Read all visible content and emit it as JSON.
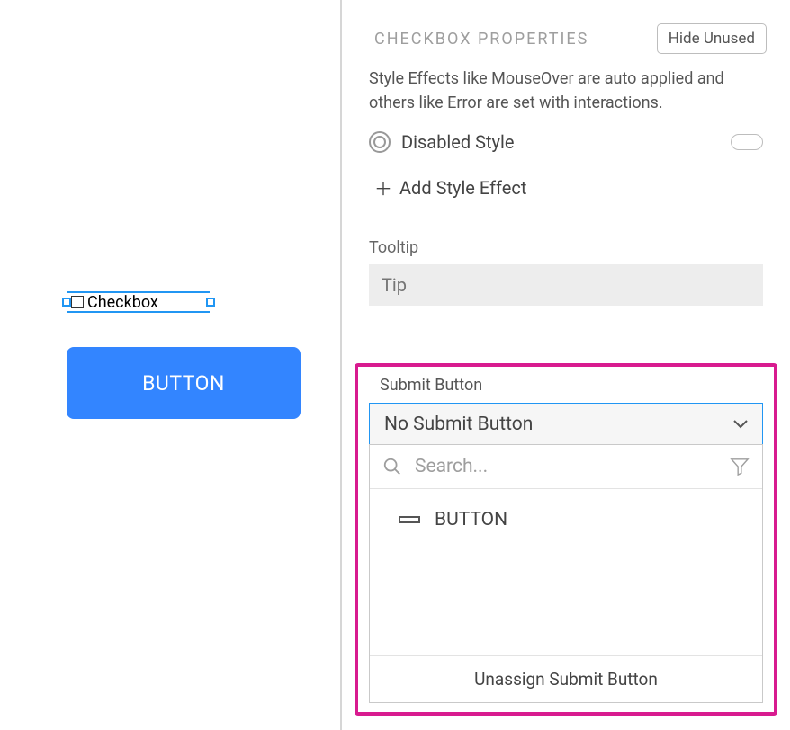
{
  "canvas": {
    "checkbox_label": "Checkbox",
    "button_label": "BUTTON"
  },
  "panel": {
    "header_title": "CHECKBOX PROPERTIES",
    "hide_unused_label": "Hide Unused",
    "description": "Style Effects like MouseOver are auto applied and others like Error are set with interactions.",
    "disabled_style_label": "Disabled Style",
    "add_style_effect_label": "Add Style Effect",
    "tooltip_label": "Tooltip",
    "tooltip_placeholder": "Tip"
  },
  "submit": {
    "section_label": "Submit Button",
    "selected_value": "No Submit Button",
    "search_placeholder": "Search...",
    "options": [
      {
        "label": "BUTTON"
      }
    ],
    "unassign_label": "Unassign Submit Button"
  }
}
